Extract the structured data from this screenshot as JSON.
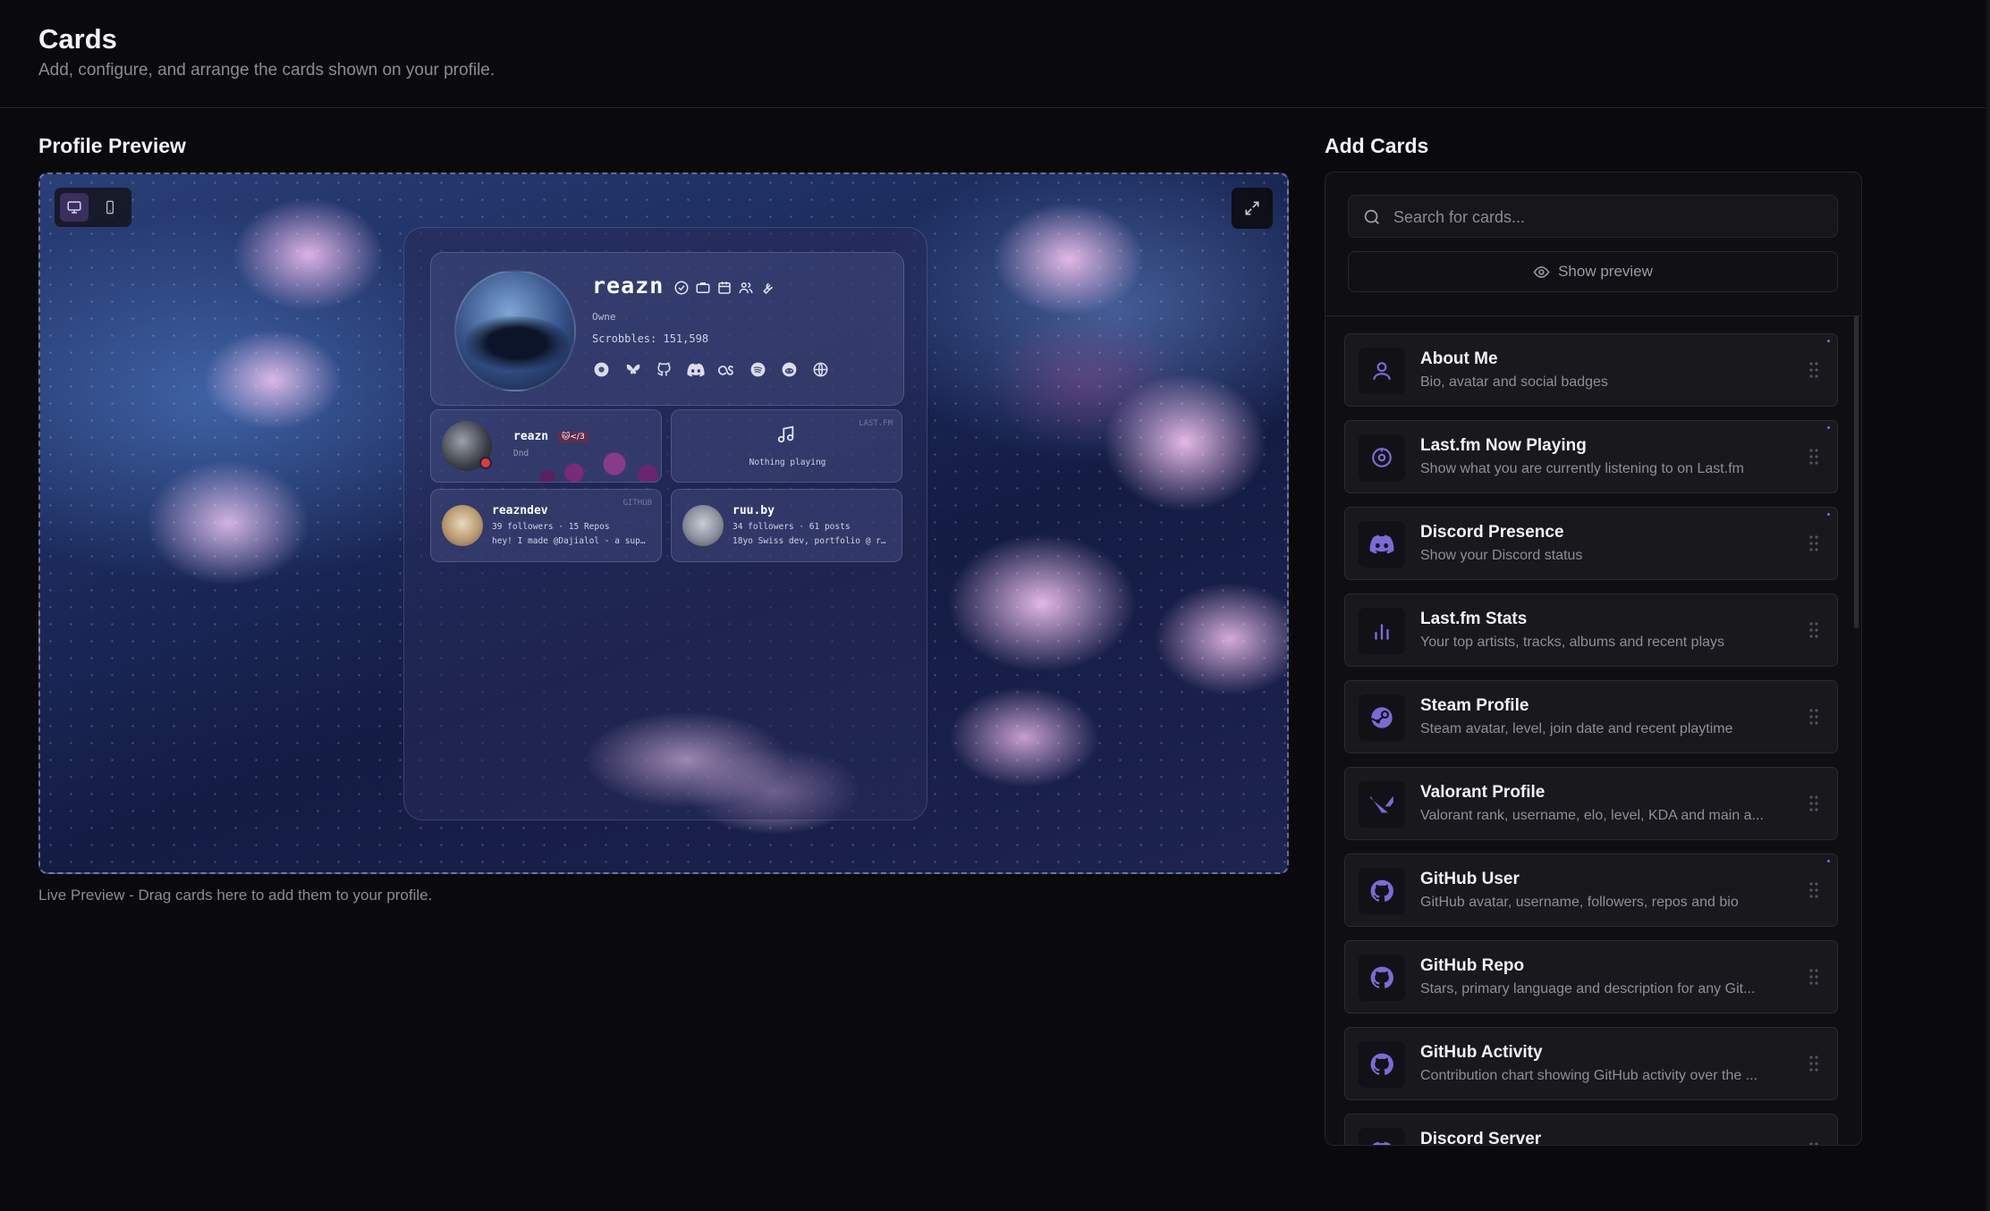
{
  "header": {
    "title": "Cards",
    "subtitle": "Add, configure, and arrange the cards shown on your profile."
  },
  "preview_section": {
    "title": "Profile Preview",
    "caption": "Live Preview - Drag cards here to add them to your profile.",
    "device_modes": [
      "desktop",
      "mobile"
    ],
    "active_device": "desktop"
  },
  "profile": {
    "username": "reazn",
    "role": "Owne",
    "scrobbles": "Scrobbles: 151,598",
    "badge_icons": [
      "verified-icon",
      "briefcase-icon",
      "calendar-icon",
      "users-icon",
      "tools-icon"
    ],
    "social_icons": [
      "lastfm-circle-icon",
      "bluesky-icon",
      "github-icon",
      "discord-icon",
      "lastfm-icon",
      "spotify-icon",
      "reddit-icon",
      "globe-icon"
    ],
    "discord_card": {
      "name": "reazn",
      "tag": "🐱</3",
      "status": "Dnd"
    },
    "lastfm_card": {
      "label": "LAST.FM",
      "text": "Nothing playing"
    },
    "github_card": {
      "label": "GITHUB",
      "name": "reazndev",
      "stats": "39 followers · 15 Repos",
      "bio": "hey! I made @Dajialol - a sup…"
    },
    "bluesky_card": {
      "name": "ruu.by",
      "stats": "34 followers · 61 posts",
      "bio": "18yo Swiss dev, portfolio @ r…"
    }
  },
  "add_cards": {
    "title": "Add Cards",
    "search_placeholder": "Search for cards...",
    "show_preview_label": "Show preview",
    "accent_color": "#7c6ad9",
    "items": [
      {
        "title": "About Me",
        "desc": "Bio, avatar and social badges",
        "icon": "user-icon"
      },
      {
        "title": "Last.fm Now Playing",
        "desc": "Show what you are currently listening to on Last.fm",
        "icon": "lastfm-icon"
      },
      {
        "title": "Discord Presence",
        "desc": "Show your Discord status",
        "icon": "discord-icon"
      },
      {
        "title": "Last.fm Stats",
        "desc": "Your top artists, tracks, albums and recent plays",
        "icon": "bar-chart-icon"
      },
      {
        "title": "Steam Profile",
        "desc": "Steam avatar, level, join date and recent playtime",
        "icon": "steam-icon"
      },
      {
        "title": "Valorant Profile",
        "desc": "Valorant rank, username, elo, level, KDA and main a...",
        "icon": "valorant-icon"
      },
      {
        "title": "GitHub User",
        "desc": "GitHub avatar, username, followers, repos and bio",
        "icon": "github-icon"
      },
      {
        "title": "GitHub Repo",
        "desc": "Stars, primary language and description for any Git...",
        "icon": "github-icon"
      },
      {
        "title": "GitHub Activity",
        "desc": "Contribution chart showing GitHub activity over the ...",
        "icon": "github-icon"
      },
      {
        "title": "Discord Server",
        "desc": "",
        "icon": "discord-icon"
      }
    ]
  }
}
